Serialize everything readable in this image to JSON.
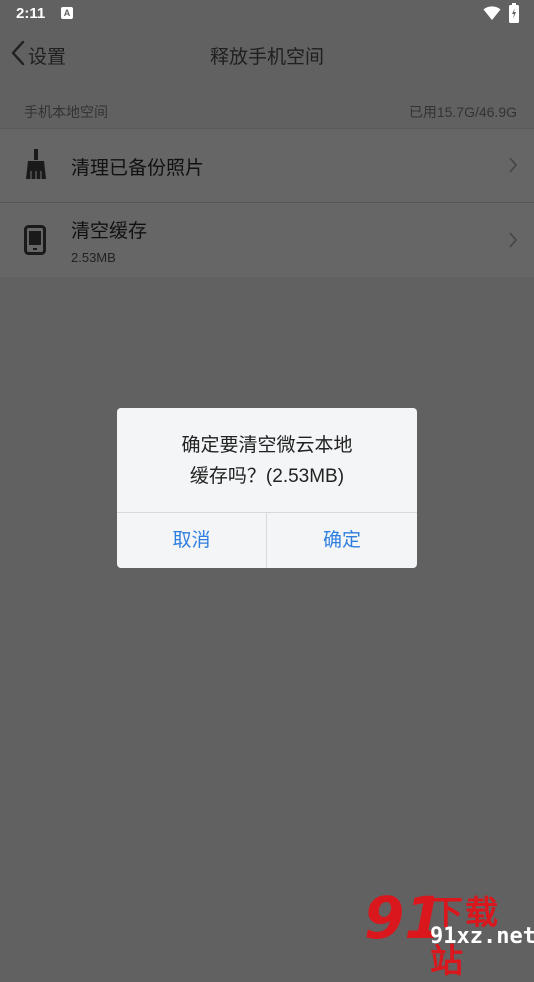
{
  "status_bar": {
    "time": "2:11",
    "notification_letter": "A"
  },
  "header": {
    "back_label": "设置",
    "title": "释放手机空间"
  },
  "section": {
    "label": "手机本地空间",
    "usage": "已用15.7G/46.9G"
  },
  "rows": [
    {
      "label": "清理已备份照片",
      "icon": "broom-icon"
    },
    {
      "label": "清空缓存",
      "sub": "2.53MB",
      "icon": "phone-icon"
    }
  ],
  "dialog": {
    "message_line1": "确定要清空微云本地",
    "message_line2": "缓存吗？(2.53MB)",
    "cancel_label": "取消",
    "confirm_label": "确定"
  },
  "watermark": {
    "brand": "下载站",
    "url": "91xz.net",
    "mark": "91"
  },
  "colors": {
    "overlay": "#616161",
    "dialog_bg": "#f3f5f6",
    "accent": "#2f7fe0",
    "watermark_red": "#d9171d"
  }
}
